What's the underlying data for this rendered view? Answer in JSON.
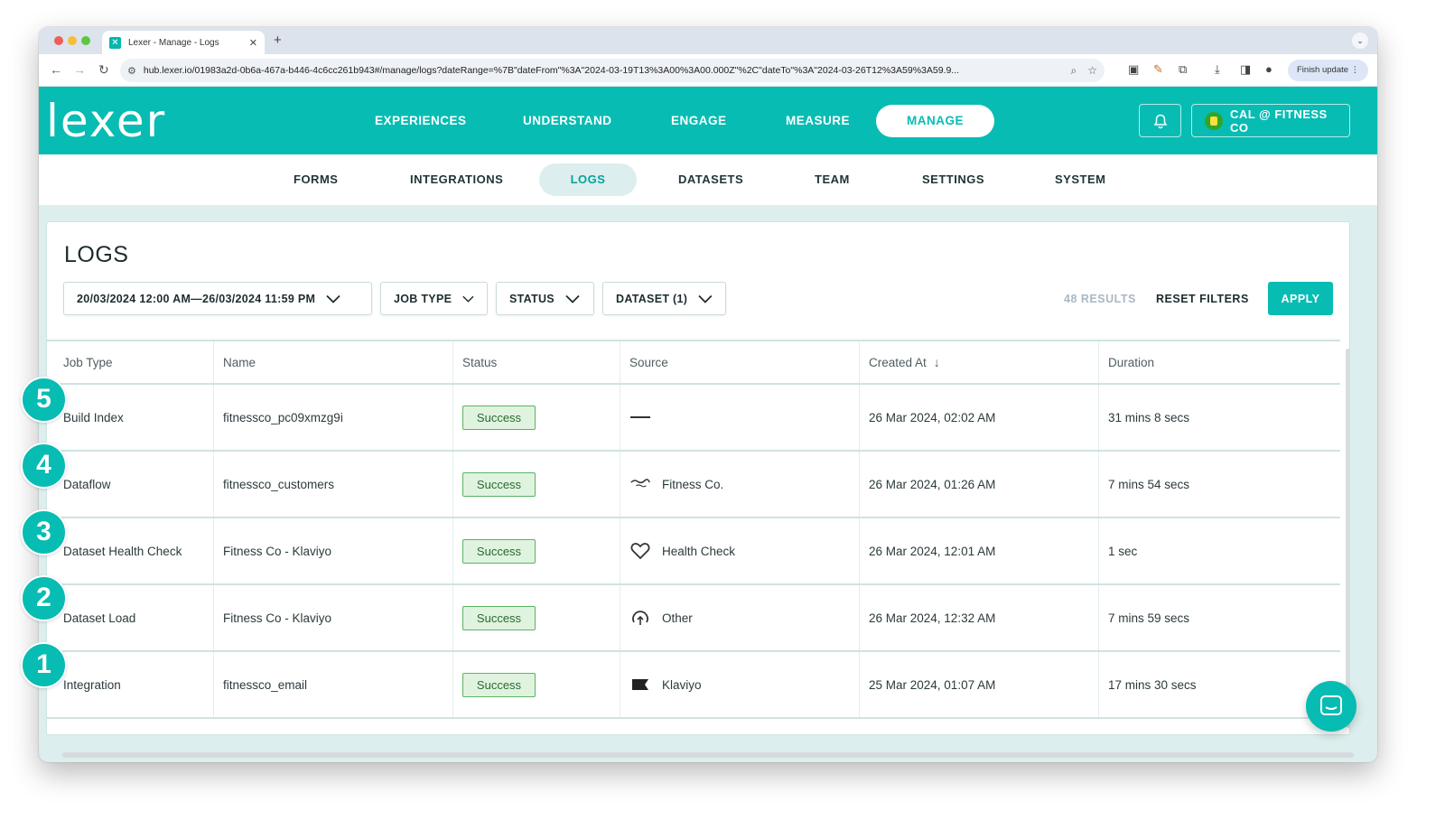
{
  "browser": {
    "tab_title": "Lexer - Manage - Logs",
    "url": "hub.lexer.io/01983a2d-0b6a-467a-b446-4c6cc261b943#/manage/logs?dateRange=%7B\"dateFrom\"%3A\"2024-03-19T13%3A00%3A00.000Z\"%2C\"dateTo\"%3A\"2024-03-26T12%3A59%3A59.9...",
    "finish_update": "Finish update"
  },
  "header": {
    "logo": "lexer",
    "nav": [
      "EXPERIENCES",
      "UNDERSTAND",
      "ENGAGE",
      "MEASURE",
      "MANAGE"
    ],
    "active_nav": "MANAGE",
    "account": "CAL @ FITNESS CO"
  },
  "subnav": {
    "items": [
      "FORMS",
      "INTEGRATIONS",
      "LOGS",
      "DATASETS",
      "TEAM",
      "SETTINGS",
      "SYSTEM"
    ],
    "active": "LOGS"
  },
  "page": {
    "title": "LOGS",
    "filters": {
      "date_range": "20/03/2024 12:00 AM—26/03/2024 11:59 PM",
      "job_type": "JOB TYPE",
      "status": "STATUS",
      "dataset": "DATASET (1)"
    },
    "results": "48 RESULTS",
    "reset": "RESET FILTERS",
    "apply": "APPLY"
  },
  "table": {
    "columns": [
      "Job Type",
      "Name",
      "Status",
      "Source",
      "Created At",
      "Duration"
    ],
    "rows": [
      {
        "marker": "5",
        "job_type": "Build Index",
        "name": "fitnessco_pc09xmzg9i",
        "status": "Success",
        "source": "",
        "source_icon": "dash-icon",
        "created_at": "26 Mar 2024, 02:02 AM",
        "duration": "31 mins 8 secs"
      },
      {
        "marker": "4",
        "job_type": "Dataflow",
        "name": "fitnessco_customers",
        "status": "Success",
        "source": "Fitness Co.",
        "source_icon": "fitness-co-logo-icon",
        "created_at": "26 Mar 2024, 01:26 AM",
        "duration": "7 mins 54 secs"
      },
      {
        "marker": "3",
        "job_type": "Dataset Health Check",
        "name": "Fitness Co - Klaviyo",
        "status": "Success",
        "source": "Health Check",
        "source_icon": "heart-icon",
        "created_at": "26 Mar 2024, 12:01 AM",
        "duration": "1 sec"
      },
      {
        "marker": "2",
        "job_type": "Dataset Load",
        "name": "Fitness Co - Klaviyo",
        "status": "Success",
        "source": "Other",
        "source_icon": "upload-cloud-icon",
        "created_at": "26 Mar 2024, 12:32 AM",
        "duration": "7 mins 59 secs"
      },
      {
        "marker": "1",
        "job_type": "Integration",
        "name": "fitnessco_email",
        "status": "Success",
        "source": "Klaviyo",
        "source_icon": "klaviyo-flag-icon",
        "created_at": "25 Mar 2024, 01:07 AM",
        "duration": "17 mins 30 secs"
      }
    ]
  },
  "colors": {
    "brand": "#07bcb3",
    "success_bg": "#dff3df",
    "success_border": "#5bb463"
  }
}
